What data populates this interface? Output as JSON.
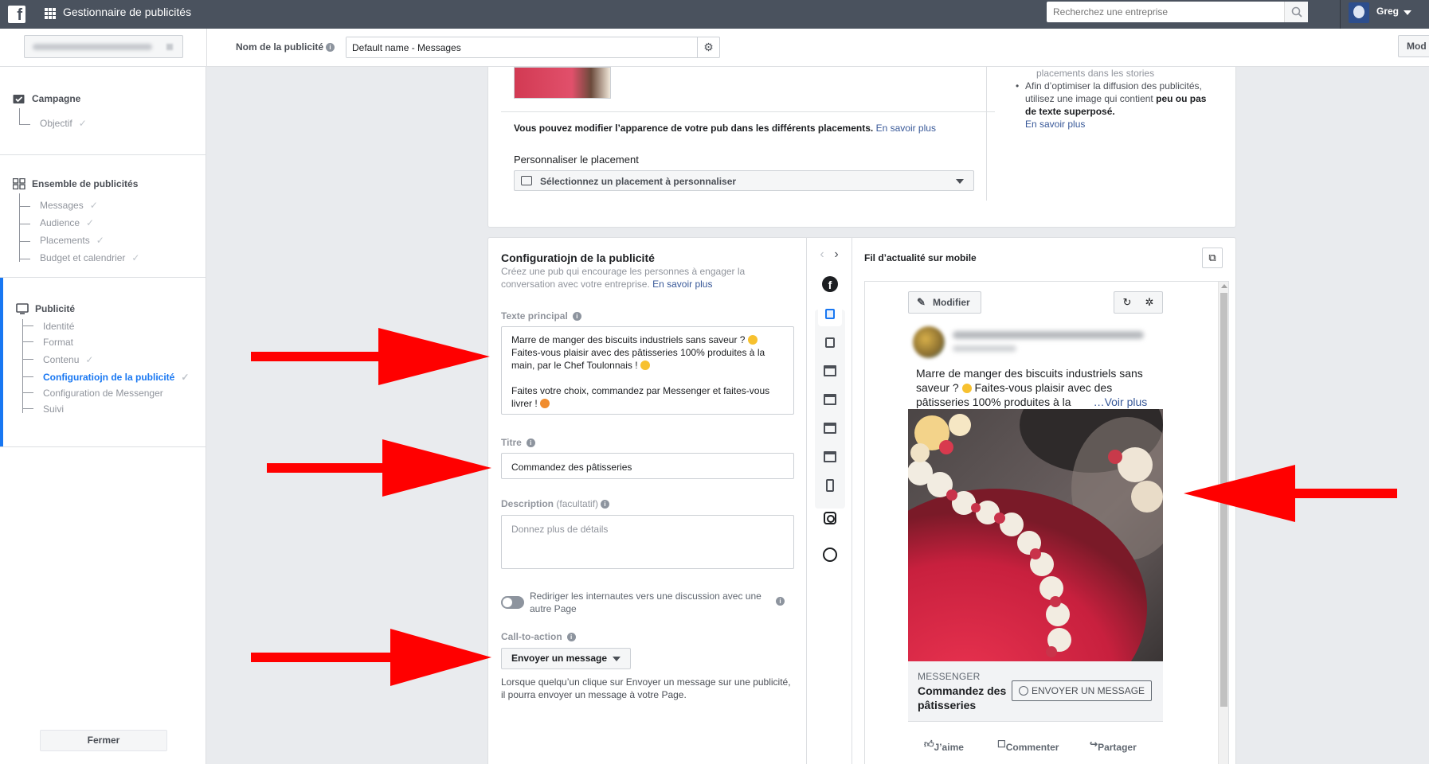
{
  "topbar": {
    "app_title": "Gestionnaire de publicités",
    "search_placeholder": "Recherchez une entreprise",
    "user_name": "Greg"
  },
  "subbar": {
    "ad_name_label": "Nom de la publicité",
    "ad_name_value": "Default name - Messages",
    "right_button": "Mod"
  },
  "sidebar": {
    "campaign": {
      "title": "Campagne",
      "items": [
        "Objectif"
      ]
    },
    "adset": {
      "title": "Ensemble de publicités",
      "items": [
        "Messages",
        "Audience",
        "Placements",
        "Budget et calendrier"
      ]
    },
    "ad": {
      "title": "Publicité",
      "items": [
        "Identité",
        "Format",
        "Contenu",
        "Configuratiojn de la publicité",
        "Configuration de Messenger",
        "Suivi"
      ],
      "active_item": "Configuratiojn de la publicité"
    },
    "close_button": "Fermer"
  },
  "placement_card": {
    "note_bold": "Vous pouvez modifier l’apparence de votre pub dans les différents placements.",
    "note_link": "En savoir plus",
    "customize_label": "Personnaliser le placement",
    "select_value": "Sélectionnez un placement à personnaliser",
    "tips": {
      "faded_line": "placements dans les stories",
      "bullet_text": "Afin d’optimiser la diffusion des publicités, utilisez une image qui contient",
      "bullet_bold": "peu ou pas de texte superposé.",
      "link": "En savoir plus"
    }
  },
  "config": {
    "title": "Configuratiojn de la publicité",
    "subtitle": "Créez une pub qui encourage les personnes à engager la conversation avec votre entreprise.",
    "subtitle_link": "En savoir plus",
    "primary_text_label": "Texte principal",
    "primary_text_line1": "Marre de manger des biscuits industriels sans saveur ?",
    "primary_text_line2": "Faites-vous plaisir avec des pâtisseries 100% produites à la main, par le Chef Toulonnais !",
    "primary_text_line3": "Faites votre choix, commandez par Messenger et faites-vous livrer !",
    "title_label": "Titre",
    "title_value": "Commandez des pâtisseries",
    "description_label": "Description",
    "description_optional": "(facultatif)",
    "description_placeholder": "Donnez plus de détails",
    "toggle_text": "Rediriger les internautes vers une discussion avec une autre Page",
    "cta_label": "Call-to-action",
    "cta_value": "Envoyer un message",
    "cta_help": "Lorsque quelqu’un clique sur Envoyer un message sur une publicité, il pourra envoyer un message à votre Page."
  },
  "preview": {
    "title": "Fil d’actualité sur mobile",
    "modify_button": "Modifier",
    "post_text": "Marre de manger des biscuits industriels sans saveur ?",
    "post_text_cont": "Faites-vous plaisir avec des pâtisseries 100% produites à la",
    "see_more": "…Voir plus",
    "footer_brand": "MESSENGER",
    "footer_title": "Commandez des pâtisseries",
    "footer_cta": "ENVOYER UN MESSAGE",
    "actions": [
      "J’aime",
      "Commenter",
      "Partager"
    ]
  },
  "colors": {
    "topbar": "#4a525e",
    "accent": "#1877f2",
    "link": "#385898",
    "annotation_arrow": "#ff0000"
  }
}
